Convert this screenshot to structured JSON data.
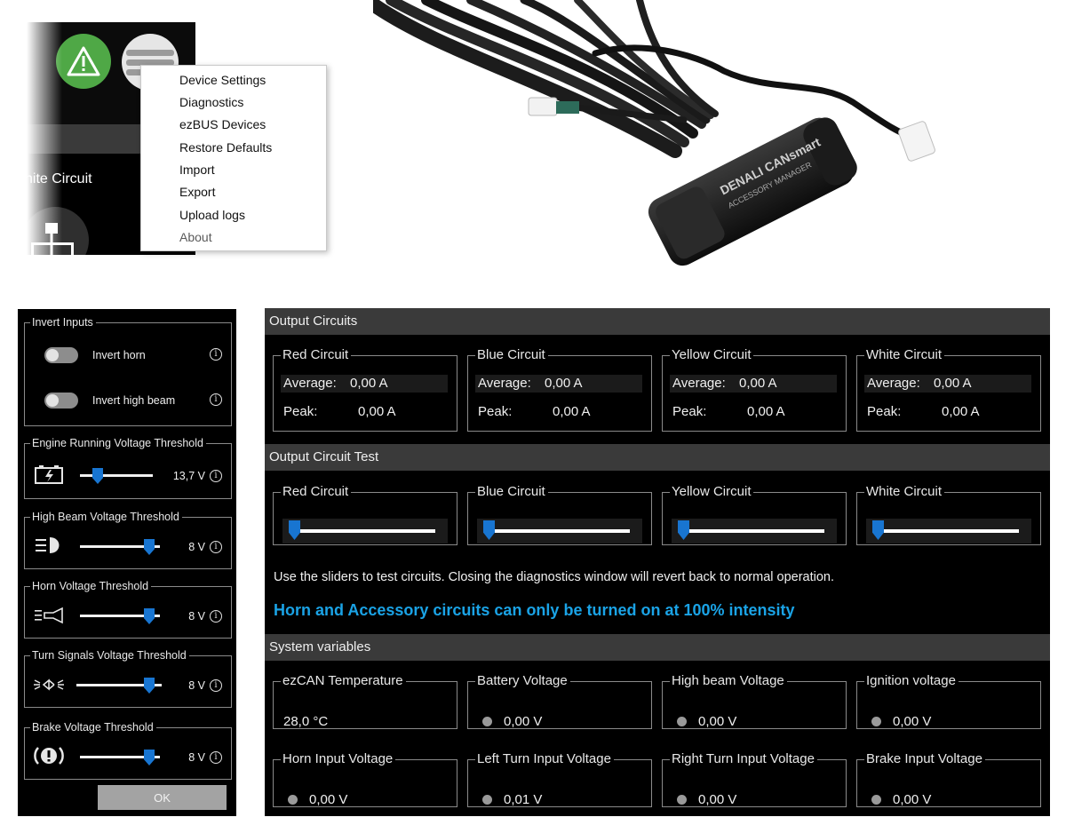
{
  "menu": {
    "items": [
      "Device Settings",
      "Diagnostics",
      "ezBUS Devices",
      "Restore Defaults",
      "Import",
      "Export",
      "Upload logs",
      "About"
    ],
    "partial_circuit_label": "hite Circuit"
  },
  "product": {
    "brand": "DENALI CANsmart",
    "subtitle": "ACCESSORY MANAGER"
  },
  "settings": {
    "invert_inputs": {
      "title": "Invert Inputs",
      "items": [
        {
          "label": "Invert horn",
          "on": false
        },
        {
          "label": "Invert high beam",
          "on": false
        }
      ]
    },
    "thresholds": [
      {
        "title": "Engine Running Voltage Threshold",
        "value": "13,7 V",
        "icon": "battery-icon",
        "level": 0.15
      },
      {
        "title": "High Beam Voltage Threshold",
        "value": "8 V",
        "icon": "high-beam-icon",
        "level": 0.95
      },
      {
        "title": "Horn Voltage Threshold",
        "value": "8 V",
        "icon": "horn-icon",
        "level": 0.95
      },
      {
        "title": "Turn Signals Voltage Threshold",
        "value": "8 V",
        "icon": "turn-signal-icon",
        "level": 0.95
      },
      {
        "title": "Brake Voltage Threshold",
        "value": "8 V",
        "icon": "brake-icon",
        "level": 0.95
      }
    ],
    "ok_label": "OK"
  },
  "diagnostics": {
    "output_circuits": {
      "title": "Output Circuits",
      "circuits": [
        {
          "name": "Red Circuit",
          "average_label": "Average:",
          "average": "0,00 A",
          "peak_label": "Peak:",
          "peak": "0,00 A"
        },
        {
          "name": "Blue Circuit",
          "average_label": "Average:",
          "average": "0,00 A",
          "peak_label": "Peak:",
          "peak": "0,00 A"
        },
        {
          "name": "Yellow Circuit",
          "average_label": "Average:",
          "average": "0,00 A",
          "peak_label": "Peak:",
          "peak": "0,00 A"
        },
        {
          "name": "White Circuit",
          "average_label": "Average:",
          "average": "0,00 A",
          "peak_label": "Peak:",
          "peak": "0,00 A"
        }
      ]
    },
    "output_circuit_test": {
      "title": "Output Circuit Test",
      "circuits": [
        {
          "name": "Red Circuit",
          "level": 0
        },
        {
          "name": "Blue Circuit",
          "level": 0
        },
        {
          "name": "Yellow Circuit",
          "level": 0
        },
        {
          "name": "White Circuit",
          "level": 0
        }
      ],
      "note": "Use the sliders to test circuits. Closing the diagnostics window will revert back to normal operation.",
      "warning": "Horn and Accessory circuits can only be turned on at 100% intensity",
      "warning_color": "#1aa3e6"
    },
    "system_variables": {
      "title": "System variables",
      "items": [
        {
          "name": "ezCAN Temperature",
          "value": "28,0 °C",
          "indicator": false
        },
        {
          "name": "Battery Voltage",
          "value": "0,00 V",
          "indicator": true
        },
        {
          "name": "High beam Voltage",
          "value": "0,00 V",
          "indicator": true
        },
        {
          "name": "Ignition voltage",
          "value": "0,00 V",
          "indicator": true
        },
        {
          "name": "Horn Input Voltage",
          "value": "0,00 V",
          "indicator": true
        },
        {
          "name": "Left Turn Input Voltage",
          "value": "0,01 V",
          "indicator": true
        },
        {
          "name": "Right Turn Input Voltage",
          "value": "0,00 V",
          "indicator": true
        },
        {
          "name": "Brake Input Voltage",
          "value": "0,00 V",
          "indicator": true
        }
      ]
    }
  }
}
